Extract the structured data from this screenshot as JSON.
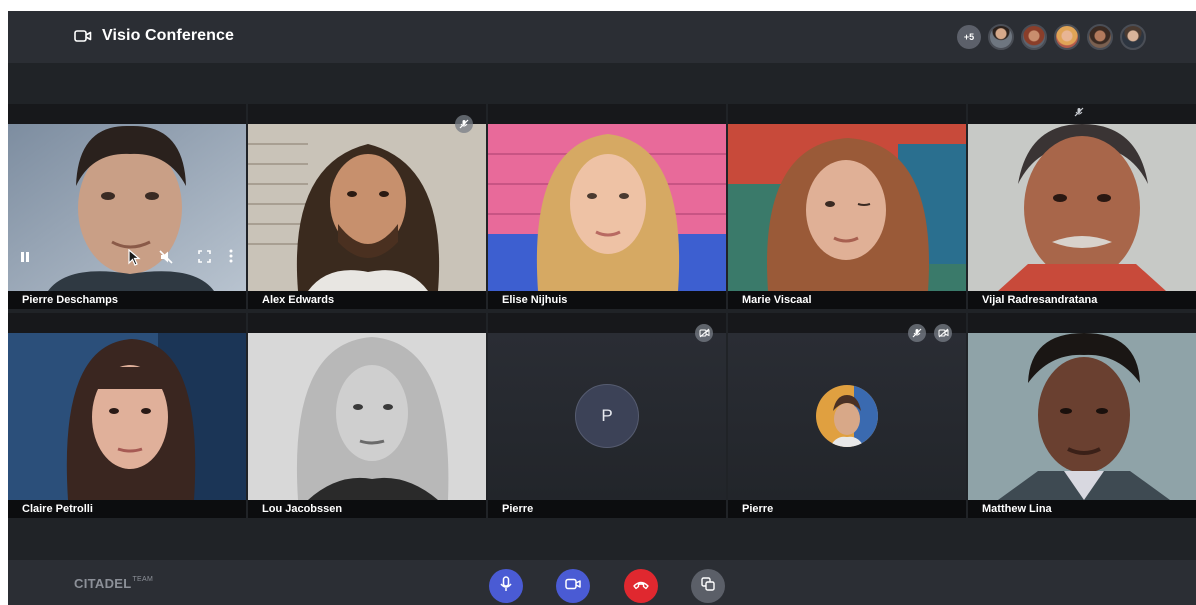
{
  "header": {
    "title": "Visio Conference",
    "extra_participants": "+5",
    "participant_avatar_count": 5
  },
  "tiles": [
    {
      "name": "Pierre Deschamps",
      "type": "video",
      "controls_visible": true
    },
    {
      "name": "Alex Edwards",
      "type": "video",
      "muted": true
    },
    {
      "name": "Elise Nijhuis",
      "type": "video"
    },
    {
      "name": "Marie Viscaal",
      "type": "video"
    },
    {
      "name": "Vijal  Radresandratana",
      "type": "video",
      "muted": true
    },
    {
      "name": "Claire Petrolli",
      "type": "video"
    },
    {
      "name": "Lou Jacobssen",
      "type": "video"
    },
    {
      "name": "Pierre",
      "type": "initials",
      "initial": "P",
      "camera_off": true
    },
    {
      "name": "Pierre",
      "type": "photo-avatar",
      "muted": true,
      "camera_off": true
    },
    {
      "name": "Matthew Lina",
      "type": "video"
    }
  ],
  "footer": {
    "brand": "CITADEL",
    "brand_suffix": "TEAM"
  },
  "colors": {
    "background": "#202327",
    "bar": "#2b2e34",
    "accent": "#4a5bd4",
    "hangup": "#e0282f",
    "neutral_button": "#5b5f68"
  },
  "icons": {
    "title": "video-camera-icon",
    "mic": "microphone-icon",
    "camera": "video-camera-icon",
    "hangup": "phone-hangup-icon",
    "share": "screen-share-icon"
  }
}
